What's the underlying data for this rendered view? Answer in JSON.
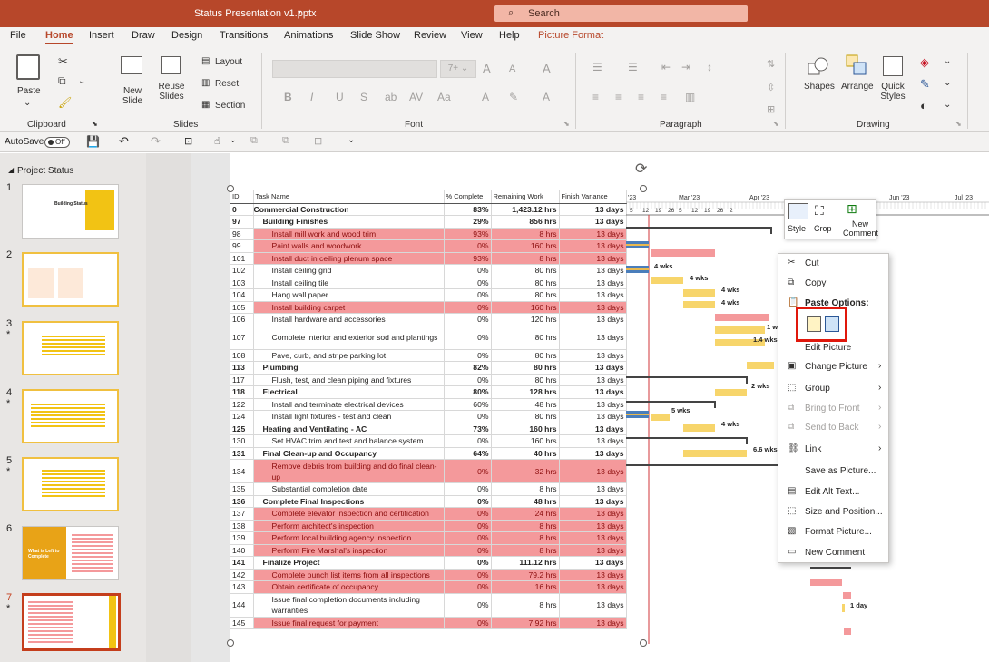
{
  "title": "Status Presentation v1.pptx",
  "search": "Search",
  "menu": [
    "File",
    "Home",
    "Insert",
    "Draw",
    "Design",
    "Transitions",
    "Animations",
    "Slide Show",
    "Review",
    "View",
    "Help",
    "Picture Format"
  ],
  "ribbon": {
    "paste": "Paste",
    "new_slide": "New Slide",
    "reuse": "Reuse Slides",
    "layout": "Layout",
    "reset": "Reset",
    "section": "Section",
    "shapes": "Shapes",
    "arrange": "Arrange",
    "quick_styles": "Quick Styles",
    "groups": {
      "clipboard": "Clipboard",
      "slides": "Slides",
      "font": "Font",
      "paragraph": "Paragraph",
      "drawing": "Drawing"
    }
  },
  "qat": {
    "autosave": "AutoSave",
    "toggle": "Off"
  },
  "thumbs": {
    "section": "Project Status",
    "nums": [
      "1",
      "2",
      "3",
      "4",
      "5",
      "6",
      "7"
    ],
    "thumb1_title": "Building Status",
    "thumb6_title": "What is Left to Complete"
  },
  "table": {
    "headers": [
      "ID",
      "Task Name",
      "% Complete",
      "Remaining Work",
      "Finish Variance"
    ],
    "rows": [
      [
        "0",
        "Commercial Construction",
        "83%",
        "1,423.12 hrs",
        "13 days"
      ],
      [
        "97",
        "Building Finishes",
        "29%",
        "856 hrs",
        "13 days"
      ],
      [
        "98",
        "Install mill work and wood trim",
        "93%",
        "8 hrs",
        "13 days"
      ],
      [
        "99",
        "Paint walls and woodwork",
        "0%",
        "160 hrs",
        "13 days"
      ],
      [
        "101",
        "Install duct in ceiling plenum space",
        "93%",
        "8 hrs",
        "13 days"
      ],
      [
        "102",
        "Install ceiling grid",
        "0%",
        "80 hrs",
        "13 days"
      ],
      [
        "103",
        "Install ceiling tile",
        "0%",
        "80 hrs",
        "13 days"
      ],
      [
        "104",
        "Hang wall paper",
        "0%",
        "80 hrs",
        "13 days"
      ],
      [
        "105",
        "Install building carpet",
        "0%",
        "160 hrs",
        "13 days"
      ],
      [
        "106",
        "Install hardware and accessories",
        "0%",
        "120 hrs",
        "13 days"
      ],
      [
        "107",
        "Complete interior and exterior sod and plantings",
        "0%",
        "80 hrs",
        "13 days"
      ],
      [
        "108",
        "Pave, curb, and stripe parking lot",
        "0%",
        "80 hrs",
        "13 days"
      ],
      [
        "113",
        "Plumbing",
        "82%",
        "80 hrs",
        "13 days"
      ],
      [
        "117",
        "Flush, test, and clean piping and fixtures",
        "0%",
        "80 hrs",
        "13 days"
      ],
      [
        "118",
        "Electrical",
        "80%",
        "128 hrs",
        "13 days"
      ],
      [
        "122",
        "Install and terminate electrical devices",
        "60%",
        "48 hrs",
        "13 days"
      ],
      [
        "124",
        "Install light fixtures - test and clean",
        "0%",
        "80 hrs",
        "13 days"
      ],
      [
        "125",
        "Heating and Ventilating - AC",
        "73%",
        "160 hrs",
        "13 days"
      ],
      [
        "130",
        "Set HVAC trim and test and balance system",
        "0%",
        "160 hrs",
        "13 days"
      ],
      [
        "131",
        "Final Clean-up and Occupancy",
        "64%",
        "40 hrs",
        "13 days"
      ],
      [
        "134",
        "Remove debris from building and do final clean-up",
        "0%",
        "32 hrs",
        "13 days"
      ],
      [
        "135",
        "Substantial completion date",
        "0%",
        "8 hrs",
        "13 days"
      ],
      [
        "136",
        "Complete Final Inspections",
        "0%",
        "48 hrs",
        "13 days"
      ],
      [
        "137",
        "Complete elevator inspection and certification",
        "0%",
        "24 hrs",
        "13 days"
      ],
      [
        "138",
        "Perform architect's inspection",
        "0%",
        "8 hrs",
        "13 days"
      ],
      [
        "139",
        "Perform local building agency inspection",
        "0%",
        "8 hrs",
        "13 days"
      ],
      [
        "140",
        "Perform Fire Marshal's inspection",
        "0%",
        "8 hrs",
        "13 days"
      ],
      [
        "141",
        "Finalize Project",
        "0%",
        "111.12 hrs",
        "13 days"
      ],
      [
        "142",
        "Complete punch list items from all inspections",
        "0%",
        "79.2 hrs",
        "13 days"
      ],
      [
        "143",
        "Obtain certificate of occupancy",
        "0%",
        "16 hrs",
        "13 days"
      ],
      [
        "144",
        "Issue final completion documents including warranties",
        "0%",
        "8 hrs",
        "13 days"
      ],
      [
        "145",
        "Issue final request for payment",
        "0%",
        "7.92 hrs",
        "13 days"
      ]
    ]
  },
  "gantt": {
    "dates": [
      "'23",
      "Mar '23",
      "Apr '23",
      "Jun '23",
      "Jul '23"
    ],
    "days": [
      "5",
      "12",
      "19",
      "26",
      "5",
      "12",
      "19",
      "26",
      "2"
    ],
    "labels": [
      "4 wks",
      "4 wks",
      "4 wks",
      "4 wks",
      "1 w",
      "1.4 wks",
      "2 wks",
      "5 wks",
      "4 wks",
      "6.6 wks",
      "1 day"
    ]
  },
  "mini": {
    "style": "Style",
    "crop": "Crop",
    "new_comment": "New Comment"
  },
  "ctx": [
    "Cut",
    "Copy",
    "Paste Options:",
    "Edit Picture",
    "Change Picture",
    "Group",
    "Bring to Front",
    "Send to Back",
    "Link",
    "Save as Picture...",
    "Edit Alt Text...",
    "Size and Position...",
    "Format Picture...",
    "New Comment"
  ]
}
